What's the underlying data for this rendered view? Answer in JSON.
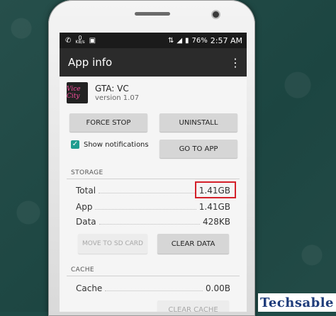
{
  "statusbar": {
    "net_value": "0",
    "net_unit": "KB/s",
    "battery": "76%",
    "time": "2:57 AM"
  },
  "appbar": {
    "title": "App info",
    "menu_icon": "⋮"
  },
  "app": {
    "name": "GTA: VC",
    "version": "version 1.07",
    "icon_text": "Vice City"
  },
  "buttons": {
    "force_stop": "FORCE STOP",
    "uninstall": "UNINSTALL",
    "go_to_app": "GO TO APP",
    "move_to_sd": "MOVE TO SD CARD",
    "clear_data": "CLEAR DATA",
    "clear_cache": "CLEAR CACHE"
  },
  "notifications": {
    "label": "Show notifications",
    "checked": true
  },
  "storage": {
    "title": "STORAGE",
    "rows": [
      {
        "label": "Total",
        "value": "1.41GB"
      },
      {
        "label": "App",
        "value": "1.41GB"
      },
      {
        "label": "Data",
        "value": "428KB"
      }
    ]
  },
  "cache": {
    "title": "CACHE",
    "rows": [
      {
        "label": "Cache",
        "value": "0.00B"
      }
    ]
  },
  "watermark": "Techsable",
  "colors": {
    "background": "#1f4a46",
    "appbar": "#2b2b2b",
    "checkbox": "#1f9c8f",
    "highlight": "#d4202a",
    "watermark_text": "#1e3c7b"
  }
}
